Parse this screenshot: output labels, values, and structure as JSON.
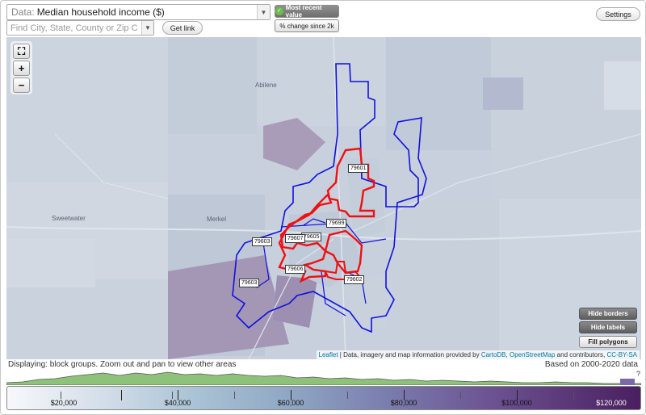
{
  "toolbar": {
    "data_prefix": "Data:",
    "data_value": "Median household income ($)",
    "find_placeholder": "Find City, State, County or Zip Code",
    "get_link_label": "Get link",
    "most_recent_label": "Most recent value",
    "pct_change_label": "% change since 2k",
    "settings_label": "Settings"
  },
  "map": {
    "zoom_extent_icon": "fullscreen-icon",
    "zoom_in_label": "+",
    "zoom_out_label": "−",
    "buttons": {
      "hide_borders": "Hide borders",
      "hide_labels": "Hide labels",
      "fill_polygons": "Fill polygons"
    },
    "zip_labels": [
      "79601",
      "79699",
      "79605",
      "79607",
      "79603",
      "79606",
      "79602"
    ],
    "place_labels": [
      "Abilene",
      "Merkel",
      "Sweetwater"
    ],
    "colors": {
      "red_border": "#ee1111",
      "blue_border": "#1111dd"
    }
  },
  "attribution": {
    "leaflet": "Leaflet",
    "text_a": " | Data, imagery and map information provided by ",
    "cartodb": "CartoDB",
    "text_b": ", ",
    "osm": "OpenStreetMap",
    "text_c": " and contributors, ",
    "license": "CC-BY-SA"
  },
  "status": {
    "displaying": "Displaying: block groups. Zoom out and pan to view other areas",
    "based_on": "Based on 2000-2020 data"
  },
  "legend": {
    "labels": [
      "$20,000",
      "$40,000",
      "$60,000",
      "$80,000",
      "$100,000",
      "$120,000"
    ],
    "question_mark": "?"
  }
}
